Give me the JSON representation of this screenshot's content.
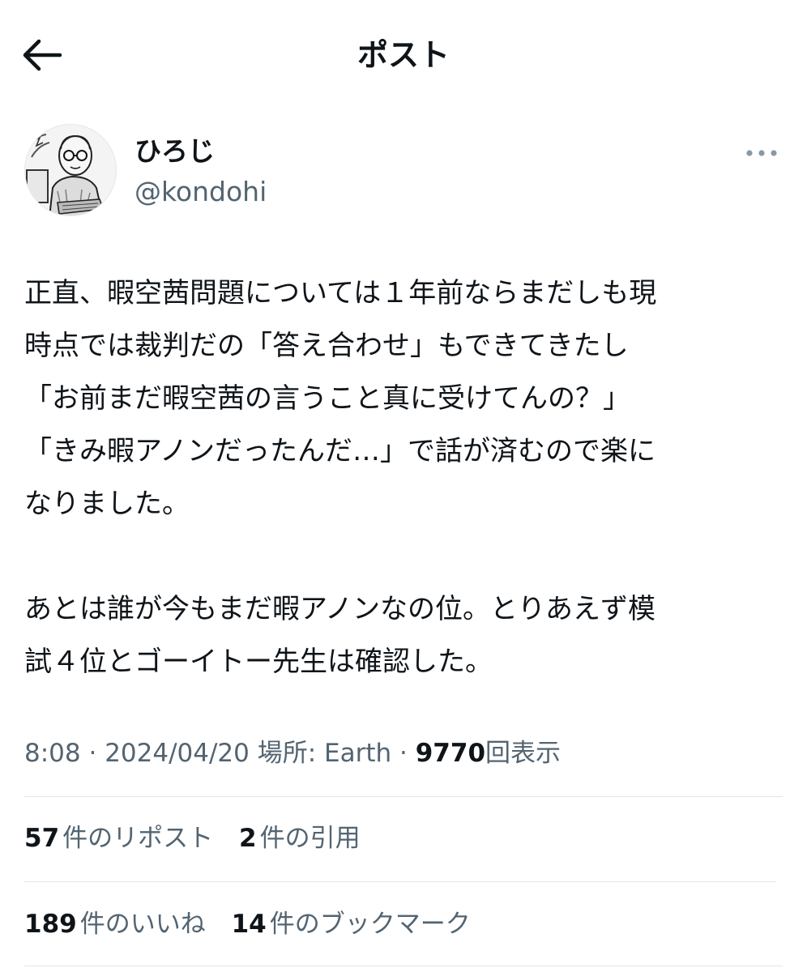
{
  "header": {
    "title": "ポスト",
    "back_icon": "arrow-left-icon"
  },
  "author": {
    "display_name": "ひろじ",
    "handle": "@kondohi",
    "avatar_icon": "cartoon-man-at-computer-avatar",
    "more_icon": "more-horizontal-icon"
  },
  "post": {
    "lines": [
      "正直、暇空茜問題については１年前ならまだしも現",
      "時点では裁判だの「答え合わせ」もできてきたし",
      "「お前まだ暇空茜の言うこと真に受けてんの？」",
      "「きみ暇アノンだったんだ…」で話が済むので楽に",
      "なりました。",
      "",
      "あとは誰が今もまだ暇アノンなの位。とりあえず模",
      "試４位とゴーイトー先生は確認した。"
    ]
  },
  "meta": {
    "time": "8:08",
    "sep1": " · ",
    "date": "2024/04/20",
    "location": "場所: Earth",
    "sep2": " · ",
    "views_count": "9770",
    "views_label": "回表示"
  },
  "stats": {
    "reposts_count": "57",
    "reposts_label": "件のリポスト",
    "quotes_count": "2",
    "quotes_label": "件の引用",
    "likes_count": "189",
    "likes_label": "件のいいね",
    "bookmarks_count": "14",
    "bookmarks_label": "件のブックマーク"
  },
  "colors": {
    "text_primary": "#0f1419",
    "text_secondary": "#536471",
    "divider": "#e1e6ea",
    "background": "#ffffff"
  }
}
